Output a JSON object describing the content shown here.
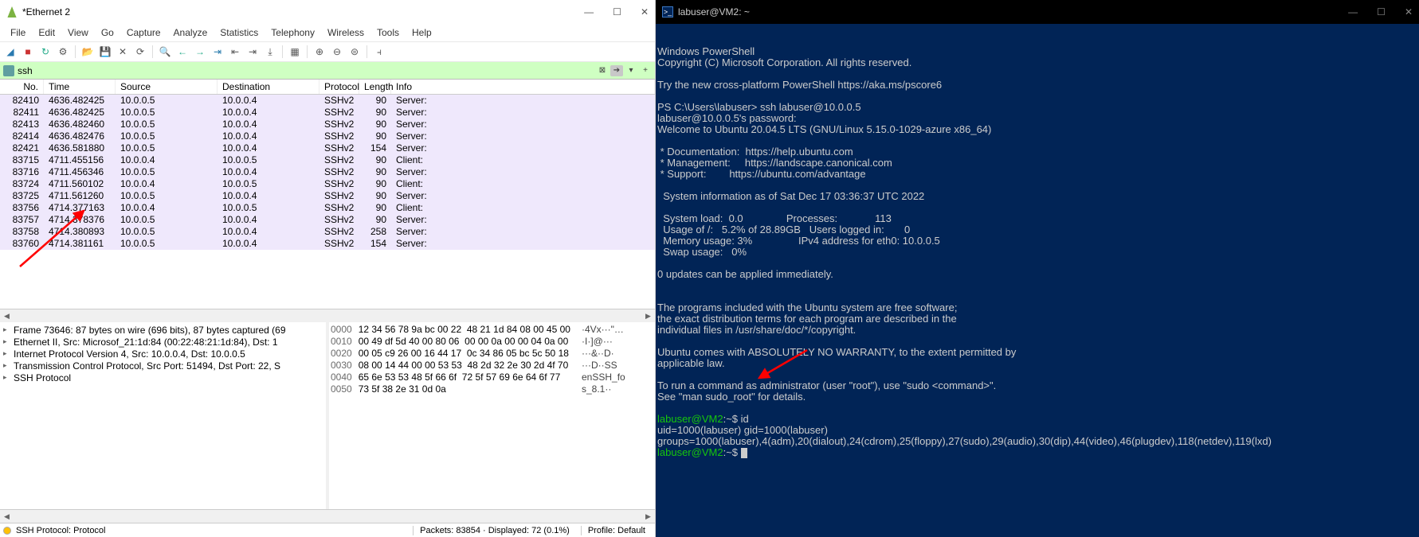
{
  "wireshark": {
    "title": "*Ethernet 2",
    "menu": [
      "File",
      "Edit",
      "View",
      "Go",
      "Capture",
      "Analyze",
      "Statistics",
      "Telephony",
      "Wireless",
      "Tools",
      "Help"
    ],
    "filter": "ssh",
    "columns": [
      "No.",
      "Time",
      "Source",
      "Destination",
      "Protocol",
      "Length",
      "Info"
    ],
    "rows": [
      {
        "no": "82410",
        "time": "4636.482425",
        "src": "10.0.0.5",
        "dst": "10.0.0.4",
        "proto": "SSHv2",
        "len": "90",
        "info": "Server:"
      },
      {
        "no": "82411",
        "time": "4636.482425",
        "src": "10.0.0.5",
        "dst": "10.0.0.4",
        "proto": "SSHv2",
        "len": "90",
        "info": "Server:"
      },
      {
        "no": "82413",
        "time": "4636.482460",
        "src": "10.0.0.5",
        "dst": "10.0.0.4",
        "proto": "SSHv2",
        "len": "90",
        "info": "Server:"
      },
      {
        "no": "82414",
        "time": "4636.482476",
        "src": "10.0.0.5",
        "dst": "10.0.0.4",
        "proto": "SSHv2",
        "len": "90",
        "info": "Server:"
      },
      {
        "no": "82421",
        "time": "4636.581880",
        "src": "10.0.0.5",
        "dst": "10.0.0.4",
        "proto": "SSHv2",
        "len": "154",
        "info": "Server:"
      },
      {
        "no": "83715",
        "time": "4711.455156",
        "src": "10.0.0.4",
        "dst": "10.0.0.5",
        "proto": "SSHv2",
        "len": "90",
        "info": "Client:"
      },
      {
        "no": "83716",
        "time": "4711.456346",
        "src": "10.0.0.5",
        "dst": "10.0.0.4",
        "proto": "SSHv2",
        "len": "90",
        "info": "Server:"
      },
      {
        "no": "83724",
        "time": "4711.560102",
        "src": "10.0.0.4",
        "dst": "10.0.0.5",
        "proto": "SSHv2",
        "len": "90",
        "info": "Client:"
      },
      {
        "no": "83725",
        "time": "4711.561260",
        "src": "10.0.0.5",
        "dst": "10.0.0.4",
        "proto": "SSHv2",
        "len": "90",
        "info": "Server:"
      },
      {
        "no": "83756",
        "time": "4714.377163",
        "src": "10.0.0.4",
        "dst": "10.0.0.5",
        "proto": "SSHv2",
        "len": "90",
        "info": "Client:"
      },
      {
        "no": "83757",
        "time": "4714.378376",
        "src": "10.0.0.5",
        "dst": "10.0.0.4",
        "proto": "SSHv2",
        "len": "90",
        "info": "Server:"
      },
      {
        "no": "83758",
        "time": "4714.380893",
        "src": "10.0.0.5",
        "dst": "10.0.0.4",
        "proto": "SSHv2",
        "len": "258",
        "info": "Server:"
      },
      {
        "no": "83760",
        "time": "4714.381161",
        "src": "10.0.0.5",
        "dst": "10.0.0.4",
        "proto": "SSHv2",
        "len": "154",
        "info": "Server:"
      }
    ],
    "details": [
      "Frame 73646: 87 bytes on wire (696 bits), 87 bytes captured (69",
      "Ethernet II, Src: Microsof_21:1d:84 (00:22:48:21:1d:84), Dst: 1",
      "Internet Protocol Version 4, Src: 10.0.0.4, Dst: 10.0.0.5",
      "Transmission Control Protocol, Src Port: 51494, Dst Port: 22, S",
      "SSH Protocol"
    ],
    "hex": [
      {
        "off": "0000",
        "b": "12 34 56 78 9a bc 00 22  48 21 1d 84 08 00 45 00",
        "a": "·4Vx···\"…"
      },
      {
        "off": "0010",
        "b": "00 49 df 5d 40 00 80 06  00 00 0a 00 00 04 0a 00",
        "a": "·I·]@···"
      },
      {
        "off": "0020",
        "b": "00 05 c9 26 00 16 44 17  0c 34 86 05 bc 5c 50 18",
        "a": "···&··D·"
      },
      {
        "off": "0030",
        "b": "08 00 14 44 00 00 53 53  48 2d 32 2e 30 2d 4f 70",
        "a": "···D··SS"
      },
      {
        "off": "0040",
        "b": "65 6e 53 53 48 5f 66 6f  72 5f 57 69 6e 64 6f 77",
        "a": "enSSH_fo"
      },
      {
        "off": "0050",
        "b": "73 5f 38 2e 31 0d 0a",
        "a": "s_8.1··"
      }
    ],
    "status": {
      "left": "SSH Protocol: Protocol",
      "mid": "Packets: 83854 · Displayed: 72 (0.1%)",
      "right": "Profile: Default"
    }
  },
  "terminal": {
    "title": "labuser@VM2: ~",
    "lines": [
      "Windows PowerShell",
      "Copyright (C) Microsoft Corporation. All rights reserved.",
      "",
      "Try the new cross-platform PowerShell https://aka.ms/pscore6",
      "",
      "PS C:\\Users\\labuser> ssh labuser@10.0.0.5",
      "labuser@10.0.0.5's password:",
      "Welcome to Ubuntu 20.04.5 LTS (GNU/Linux 5.15.0-1029-azure x86_64)",
      "",
      " * Documentation:  https://help.ubuntu.com",
      " * Management:     https://landscape.canonical.com",
      " * Support:        https://ubuntu.com/advantage",
      "",
      "  System information as of Sat Dec 17 03:36:37 UTC 2022",
      "",
      "  System load:  0.0               Processes:             113",
      "  Usage of /:   5.2% of 28.89GB   Users logged in:       0",
      "  Memory usage: 3%                IPv4 address for eth0: 10.0.0.5",
      "  Swap usage:   0%",
      "",
      "0 updates can be applied immediately.",
      "",
      "",
      "The programs included with the Ubuntu system are free software;",
      "the exact distribution terms for each program are described in the",
      "individual files in /usr/share/doc/*/copyright.",
      "",
      "Ubuntu comes with ABSOLUTELY NO WARRANTY, to the extent permitted by",
      "applicable law.",
      "",
      "To run a command as administrator (user \"root\"), use \"sudo <command>\".",
      "See \"man sudo_root\" for details.",
      ""
    ],
    "prompt1": "labuser@VM2",
    "prompt1_suffix": ":~$ id",
    "id_out": "uid=1000(labuser) gid=1000(labuser) groups=1000(labuser),4(adm),20(dialout),24(cdrom),25(floppy),27(sudo),29(audio),30(dip),44(video),46(plugdev),118(netdev),119(lxd)",
    "prompt2": "labuser@VM2",
    "prompt2_suffix": ":~$ "
  }
}
